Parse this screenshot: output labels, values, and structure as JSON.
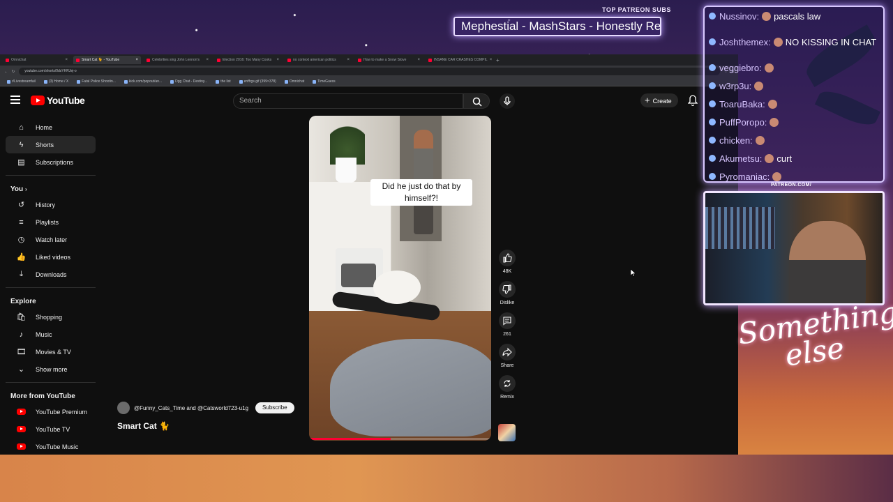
{
  "overlay": {
    "subs_title": "TOP PATREON SUBS",
    "subs_scroller": "Mephestial - MashStars - Honestly Re",
    "patreon_tag": "PATREON.COM/",
    "signature": "Something else"
  },
  "browser": {
    "tabs": [
      {
        "label": "Omnichat",
        "active": false
      },
      {
        "label": "Smart Cat 🐈 - YouTube",
        "active": true
      },
      {
        "label": "Celebrities sing John Lennon's",
        "active": false
      },
      {
        "label": "Election 2016: Too Many Cooks",
        "active": false
      },
      {
        "label": "no context american politics",
        "active": false
      },
      {
        "label": "How to make a Snow Stove",
        "active": false
      },
      {
        "label": "INSANE CAR CRASHES COMPIL",
        "active": false
      }
    ],
    "url": "youtube.com/shorts/0dsYHRJej-o",
    "bookmarks": [
      "r/Livestreamfail",
      "(3) Home / X",
      "Fatal Police Shootin...",
      "kick.com/popout/an...",
      "Dgg Chat - Destiny...",
      "the list",
      "enffrgs.gif (399×378)",
      "Omnichat",
      "TimeGuess"
    ]
  },
  "youtube": {
    "logo_text": "YouTube",
    "search_placeholder": "Search",
    "create_label": "Create",
    "sidebar": {
      "main": [
        {
          "label": "Home",
          "icon": "home-icon"
        },
        {
          "label": "Shorts",
          "icon": "shorts-icon",
          "active": true
        },
        {
          "label": "Subscriptions",
          "icon": "subscriptions-icon"
        }
      ],
      "you_header": "You",
      "you": [
        {
          "label": "History",
          "icon": "history-icon"
        },
        {
          "label": "Playlists",
          "icon": "playlists-icon"
        },
        {
          "label": "Watch later",
          "icon": "watch-later-icon"
        },
        {
          "label": "Liked videos",
          "icon": "liked-videos-icon"
        },
        {
          "label": "Downloads",
          "icon": "downloads-icon"
        }
      ],
      "explore_header": "Explore",
      "explore": [
        {
          "label": "Shopping",
          "icon": "shopping-icon"
        },
        {
          "label": "Music",
          "icon": "music-icon"
        },
        {
          "label": "Movies & TV",
          "icon": "movies-icon"
        },
        {
          "label": "Show more",
          "icon": "chevron-down-icon"
        }
      ],
      "more_header": "More from YouTube",
      "more": [
        {
          "label": "YouTube Premium"
        },
        {
          "label": "YouTube TV"
        },
        {
          "label": "YouTube Music"
        }
      ]
    },
    "short": {
      "caption": "Did he just do that by himself?!",
      "channel": "@Funny_Cats_Time and @Catsworld723-u1g",
      "subscribe_label": "Subscribe",
      "title": "Smart Cat 🐈",
      "progress": 0.45,
      "likes": "48K",
      "dislike_label": "Dislike",
      "comments": "261",
      "share_label": "Share",
      "remix_label": "Remix"
    }
  },
  "chat": {
    "messages": [
      {
        "user": "Nussinov:",
        "text": "pascals law"
      },
      {
        "user": "Joshthemex:",
        "text": "NO KISSING IN CHAT"
      },
      {
        "user": "veggiebro:",
        "text": ""
      },
      {
        "user": "w3rp3u:",
        "text": ""
      },
      {
        "user": "ToaruBaka:",
        "text": ""
      },
      {
        "user": "PuffPoropo:",
        "text": ""
      },
      {
        "user": "chicken:",
        "text": ""
      },
      {
        "user": "Akumetsu:",
        "text": "curt"
      },
      {
        "user": "Pyromaniac:",
        "text": ""
      }
    ]
  }
}
